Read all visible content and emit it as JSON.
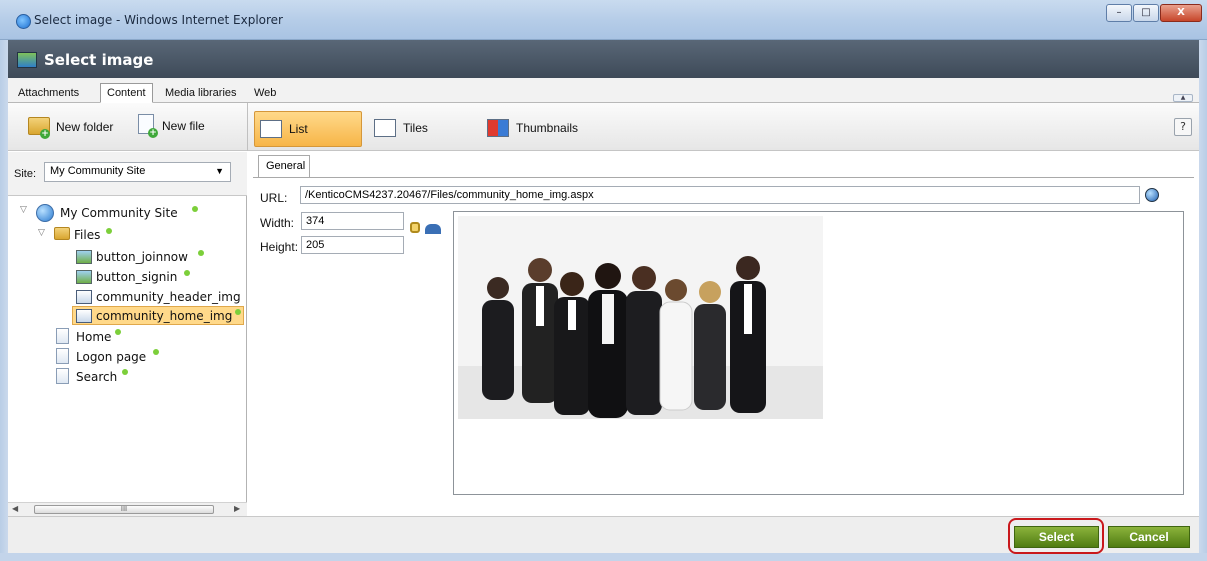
{
  "window": {
    "title": "Select image - Windows Internet Explorer",
    "min": "–",
    "max": "□",
    "close": "X"
  },
  "header": {
    "title": "Select image"
  },
  "tabs": [
    "Attachments",
    "Content",
    "Media libraries",
    "Web"
  ],
  "active_tab": "Content",
  "toolbar": {
    "new_folder": "New folder",
    "new_file": "New file",
    "list": "List",
    "tiles": "Tiles",
    "thumbnails": "Thumbnails",
    "help": "?"
  },
  "site": {
    "label": "Site:",
    "value": "My Community Site"
  },
  "tree": {
    "root": "My Community Site",
    "files": "Files",
    "children": [
      "button_joinnow",
      "button_signin",
      "community_header_img",
      "community_home_img"
    ],
    "pages": [
      "Home",
      "Logon page",
      "Search"
    ]
  },
  "scroll_mark": "III",
  "props": {
    "tab": "General",
    "url_label": "URL:",
    "url": "/KenticoCMS4237.20467/Files/community_home_img.aspx",
    "width_label": "Width:",
    "width": "374",
    "height_label": "Height:",
    "height": "205"
  },
  "buttons": {
    "select": "Select",
    "cancel": "Cancel"
  },
  "colors": {
    "accent_green": "#6e9a25",
    "highlight": "#c9181c",
    "selected_row": "#ffd98a"
  }
}
